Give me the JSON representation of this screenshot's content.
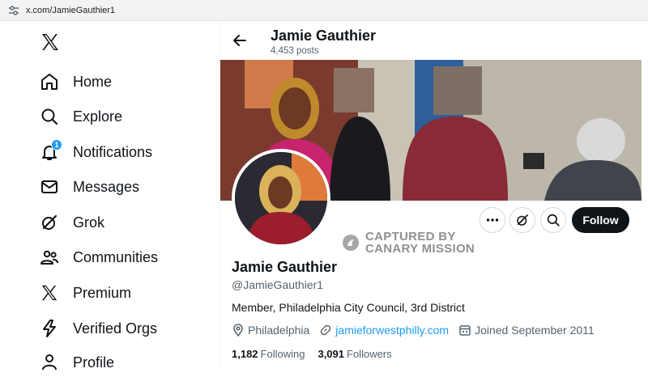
{
  "browser": {
    "url": "x.com/JamieGauthier1"
  },
  "nav": {
    "items": [
      {
        "label": "Home",
        "icon": "home-icon"
      },
      {
        "label": "Explore",
        "icon": "search-icon"
      },
      {
        "label": "Notifications",
        "icon": "bell-icon",
        "badge": "1"
      },
      {
        "label": "Messages",
        "icon": "envelope-icon"
      },
      {
        "label": "Grok",
        "icon": "grok-icon"
      },
      {
        "label": "Communities",
        "icon": "people-icon"
      },
      {
        "label": "Premium",
        "icon": "x-logo-icon"
      },
      {
        "label": "Verified Orgs",
        "icon": "lightning-icon"
      },
      {
        "label": "Profile",
        "icon": "person-icon"
      }
    ]
  },
  "header": {
    "name": "Jamie Gauthier",
    "posts": "4,453 posts"
  },
  "profile": {
    "name": "Jamie Gauthier",
    "handle": "@JamieGauthier1",
    "bio": "Member, Philadelphia City Council, 3rd District",
    "location": "Philadelphia",
    "website": "jamieforwestphilly.com",
    "joined": "Joined September 2011",
    "following_count": "1,182",
    "following_label": "Following",
    "followers_count": "3,091",
    "followers_label": "Followers",
    "follow_label": "Follow"
  },
  "watermark": {
    "line1": "CAPTURED BY",
    "line2": "CANARY MISSION"
  },
  "colors": {
    "accent": "#1d9bf0",
    "text": "#0f1419",
    "muted": "#536471"
  }
}
